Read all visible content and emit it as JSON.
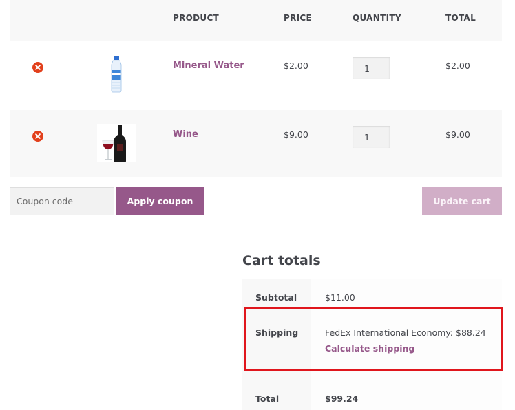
{
  "table": {
    "headers": {
      "product": "PRODUCT",
      "price": "PRICE",
      "quantity": "QUANTITY",
      "total": "TOTAL"
    },
    "rows": [
      {
        "name": "Mineral Water",
        "price": "$2.00",
        "quantity": "1",
        "total": "$2.00",
        "thumb_icon": "water-bottle-icon"
      },
      {
        "name": "Wine",
        "price": "$9.00",
        "quantity": "1",
        "total": "$9.00",
        "thumb_icon": "wine-bottle-icon"
      }
    ]
  },
  "coupon": {
    "placeholder": "Coupon code",
    "apply_label": "Apply coupon"
  },
  "update_label": "Update cart",
  "totals": {
    "title": "Cart totals",
    "subtotal_label": "Subtotal",
    "subtotal_value": "$11.00",
    "shipping_label": "Shipping",
    "shipping_value": "FedEx International Economy: $88.24",
    "calc_shipping": "Calculate shipping",
    "total_label": "Total",
    "total_value": "$99.24"
  },
  "colors": {
    "accent": "#96588a",
    "remove": "#e2401c",
    "highlight": "#e0161d",
    "update_disabled": "#d1aec7"
  }
}
